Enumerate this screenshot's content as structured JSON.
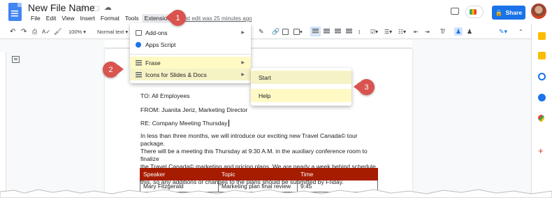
{
  "doc": {
    "title": "New File Name",
    "last_edit": "Last edit was 25 minutes ago"
  },
  "menubar": [
    "File",
    "Edit",
    "View",
    "Insert",
    "Format",
    "Tools",
    "Extensions"
  ],
  "header": {
    "share_label": "Share"
  },
  "toolbar": {
    "zoom": "100%",
    "style": "Normal text"
  },
  "extensions_menu": {
    "items": [
      "Add-ons",
      "Apps Script",
      "Frase",
      "Icons for Slides & Docs"
    ]
  },
  "submenu": {
    "items": [
      "Start",
      "Help"
    ]
  },
  "callouts": [
    "1",
    "2",
    "3"
  ],
  "document": {
    "to": "TO: All Employees",
    "from": "FROM: Juanita Jeriz, Marketing Director",
    "re": "RE: Company Meeting Thursday",
    "para_lines": [
      "In less than three months, we will introduce our exciting new Travel Canada© tour package.",
      "There will be a meeting this Thursday at 9:30 A.M. in the auxiliary conference room to finalize",
      "the Travel Canada© marketing and pricing plans. We are nearly a week behind schedule on",
      "this, so any additions or changes to the plans should be submitted by Friday."
    ],
    "table": {
      "headers": [
        "Speaker",
        "Topic",
        "Time"
      ],
      "rows": [
        [
          "Mary Fitzgerald",
          "Marketing plan final review",
          "9:45"
        ]
      ]
    }
  },
  "colors": {
    "accent": "#1a73e8",
    "callout": "#d9534f",
    "table_header": "#a61c00",
    "menu_highlight": "#fff9c4"
  }
}
